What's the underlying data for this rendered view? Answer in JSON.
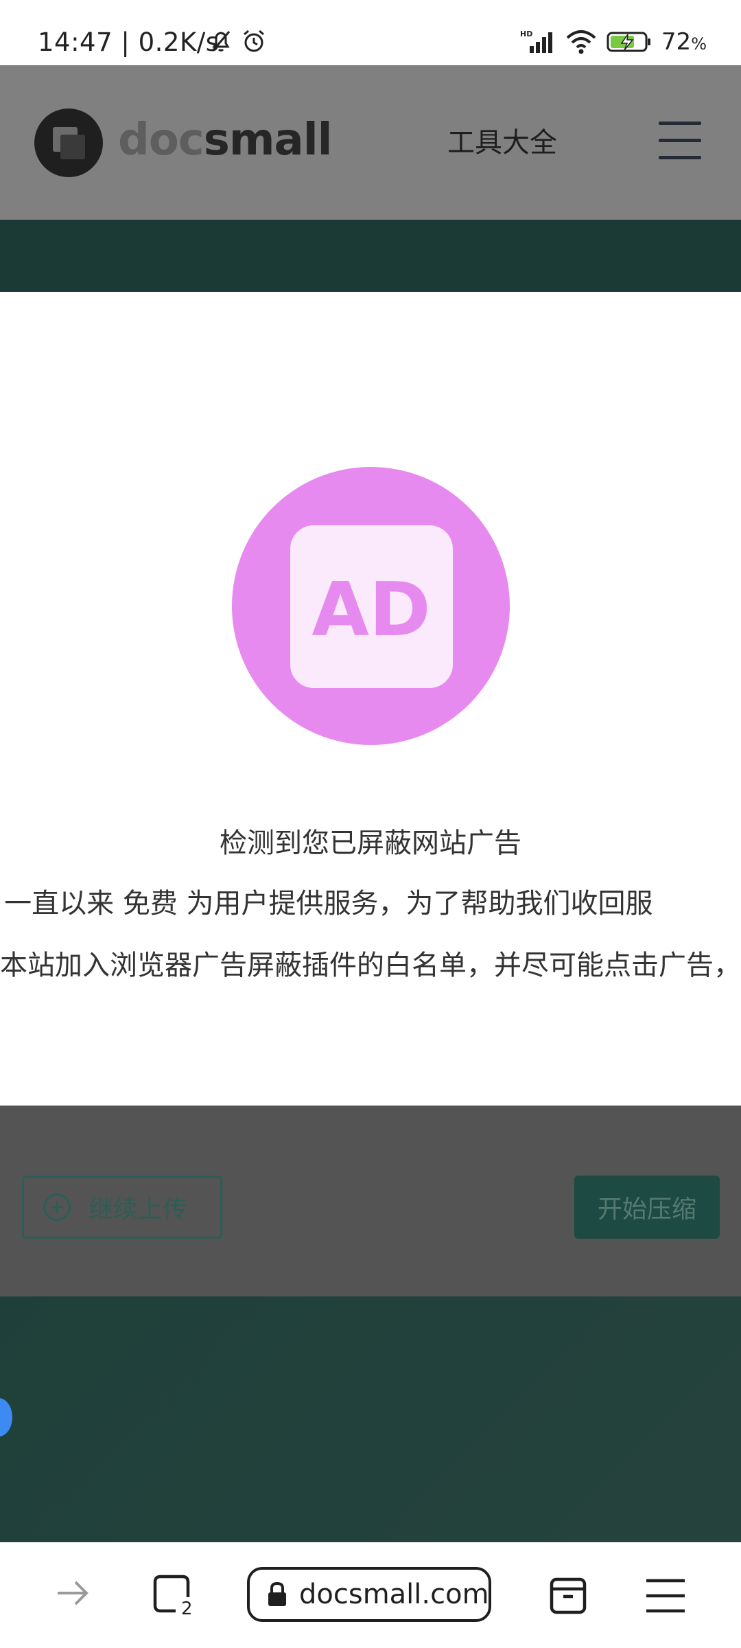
{
  "status_bar": {
    "time": "14:47 | 0.2K/s",
    "battery_percent": "72",
    "battery_suffix": "%",
    "icons": [
      "mute-bell-icon",
      "alarm-icon",
      "hd-signal-icon",
      "wifi-icon",
      "battery-charging-icon"
    ]
  },
  "site_header": {
    "logo_part1": "doc",
    "logo_part2": "small",
    "tools_link": "工具大全",
    "menu_icon": "hamburger-icon"
  },
  "ad_modal": {
    "badge_text": "AD",
    "title": "检测到您已屏蔽网站广告",
    "line1": "docsmall 一直以来 免费 为用户提供服务，为了帮助我们收回服",
    "line2": "请将本站加入浏览器广告屏蔽插件的白名单，并尽可能点击广告，",
    "accent_color": "#e68aef"
  },
  "upload_actions": {
    "continue_label": "继续上传",
    "start_label": "开始压缩"
  },
  "browser_bar": {
    "url": "docsmall.com",
    "tab_count": "2",
    "icons": [
      "forward-arrow-icon",
      "tabs-icon",
      "lock-icon",
      "archive-icon",
      "menu-icon"
    ]
  }
}
